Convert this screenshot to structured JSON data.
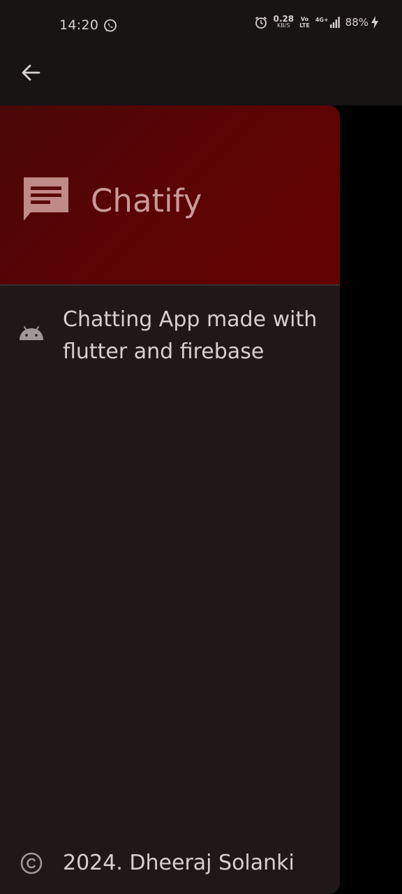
{
  "status_bar": {
    "time": "14:20",
    "net_speed_value": "0.28",
    "net_speed_unit": "KB/S",
    "volte_top": "Vo",
    "volte_bottom": "LTE",
    "network_type": "4G+",
    "battery_percent": "88%",
    "icons": [
      "whatsapp-icon",
      "alarm-icon",
      "signal-icon",
      "charging-bolt-icon"
    ]
  },
  "app_bar": {
    "back_icon": "arrow-back-icon"
  },
  "drawer": {
    "header": {
      "title": "Chatify",
      "icon": "chat-bubble-icon",
      "color": "#5c0303"
    },
    "about": {
      "icon": "android-icon",
      "text": "Chatting App made with flutter and firebase"
    },
    "footer": {
      "icon": "copyright-icon",
      "text": "2024. Dheeraj Solanki"
    }
  },
  "colors": {
    "background": "#000000",
    "drawer_bg": "#201818",
    "header_bg": "#5c0303",
    "title_text": "#c89a98",
    "body_text": "#d9cfcf"
  }
}
